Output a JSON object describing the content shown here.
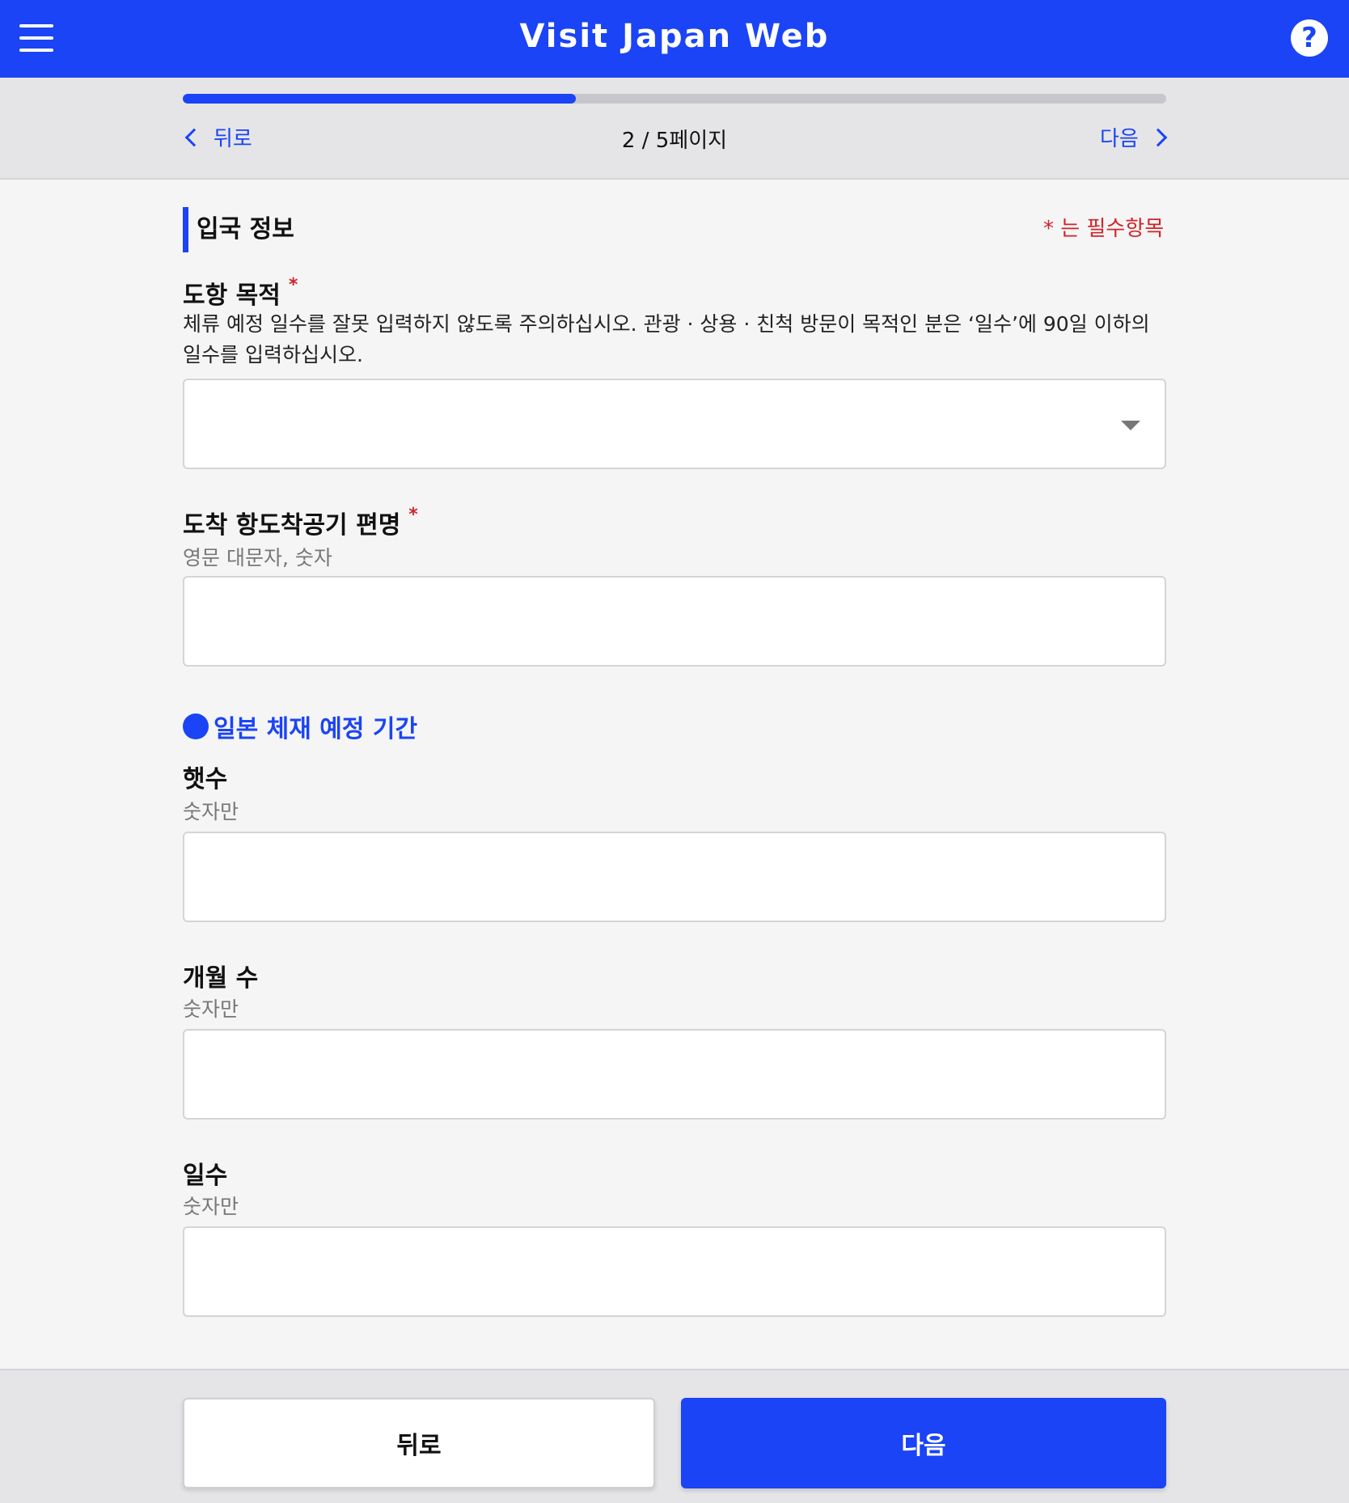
{
  "header": {
    "title": "Visit Japan Web",
    "help_icon": "?"
  },
  "stepper": {
    "progress_percent": 40,
    "back_label": "뒤로",
    "page_indicator": "2 / 5페이지",
    "next_label": "다음"
  },
  "section": {
    "title": "입국 정보",
    "required_note": "* 는 필수항목"
  },
  "purpose": {
    "label": "도항 목적",
    "star": "*",
    "description": "체류 예정 일수를 잘못 입력하지 않도록 주의하십시오. 관광 · 상용 · 친척 방문이 목적인 분은 ‘일수’에 90일 이하의 일수를 입력하십시오.",
    "value": ""
  },
  "flight": {
    "label": "도착 항도착공기 편명",
    "star": "*",
    "hint": "영문 대문자, 숫자",
    "value": ""
  },
  "stay_period": {
    "title": "일본 체재 예정 기간",
    "years": {
      "label": "햇수",
      "hint": "숫자만",
      "value": ""
    },
    "months": {
      "label": "개월 수",
      "hint": "숫자만",
      "value": ""
    },
    "days": {
      "label": "일수",
      "hint": "숫자만",
      "value": ""
    }
  },
  "footer": {
    "back_button": "뒤로",
    "next_button": "다음"
  }
}
